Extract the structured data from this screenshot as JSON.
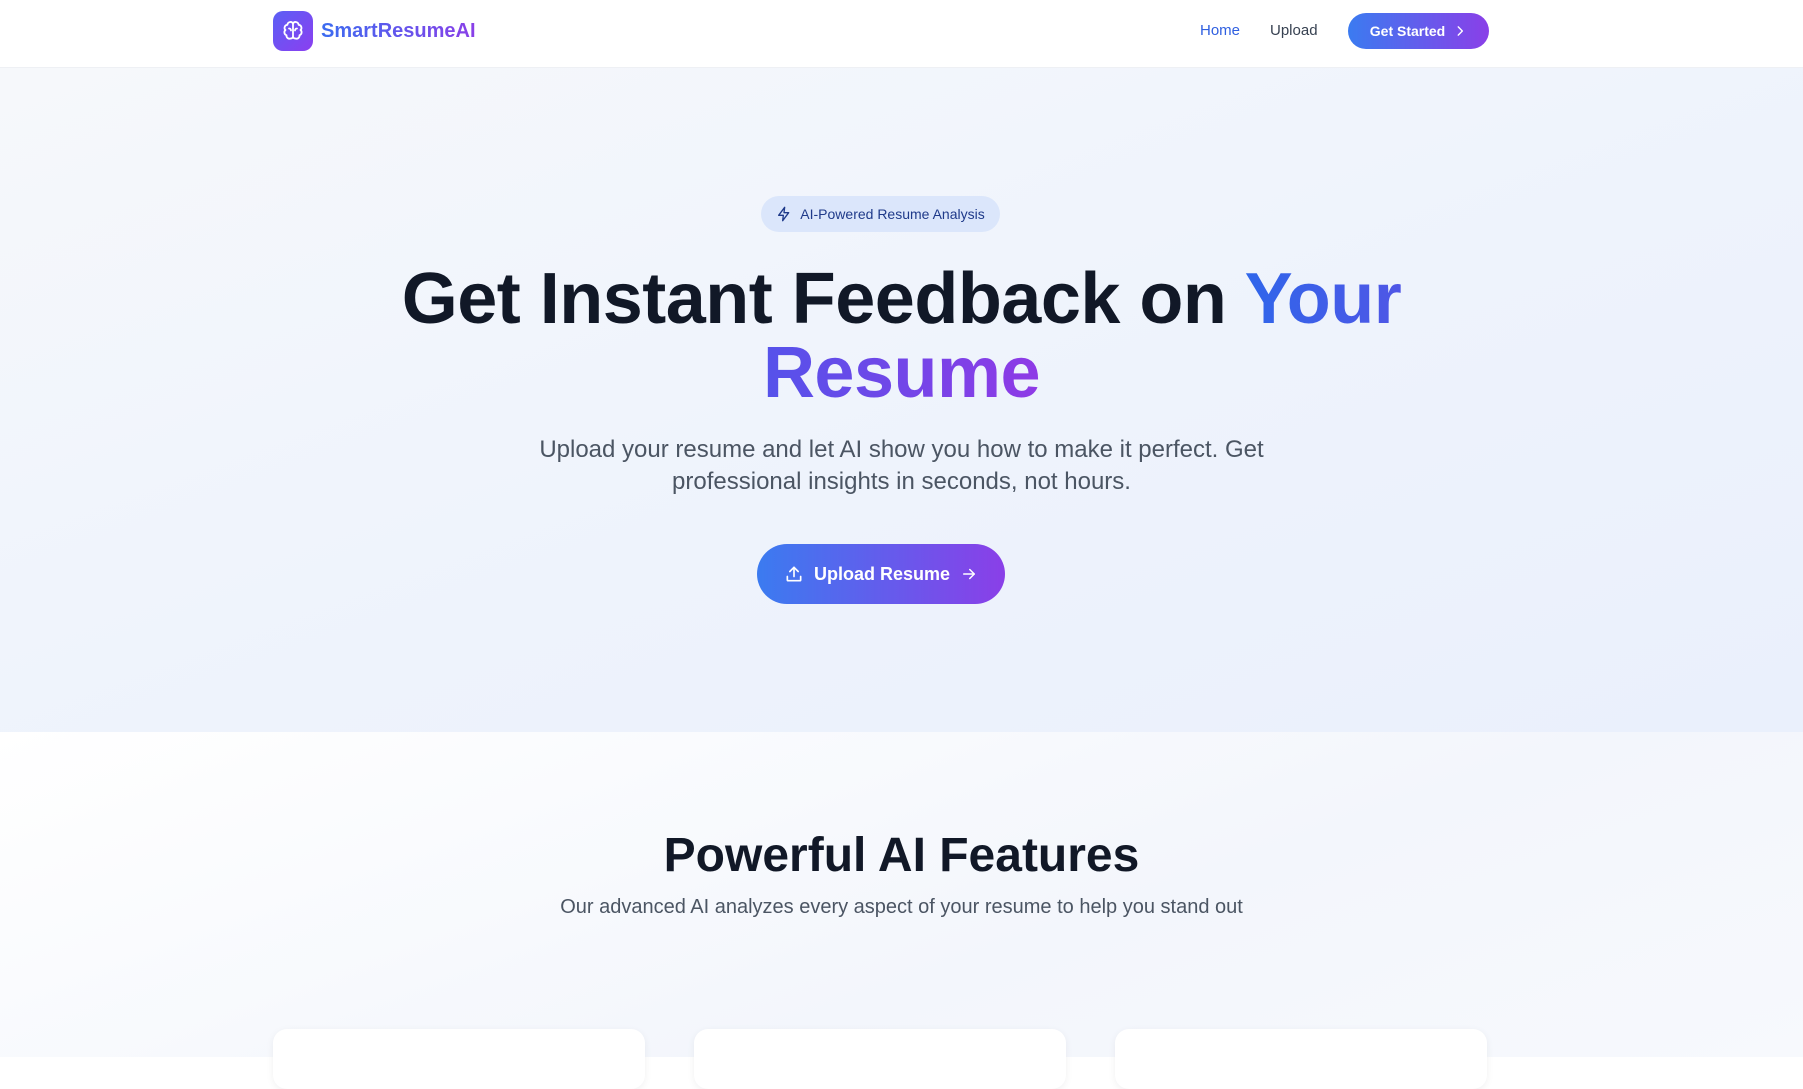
{
  "nav": {
    "brand": "SmartResumeAI",
    "links": [
      "Home",
      "Upload"
    ],
    "cta": "Get Started"
  },
  "hero": {
    "badge": "AI-Powered Resume Analysis",
    "title_plain": "Get Instant Feedback on ",
    "title_highlight_1": "Your",
    "title_highlight_2": "Resume",
    "subtitle": "Upload your resume and let AI show you how to make it perfect. Get professional insights in seconds, not hours.",
    "button": "Upload Resume"
  },
  "features": {
    "title": "Powerful AI Features",
    "subtitle": "Our advanced AI analyzes every aspect of your resume to help you stand out"
  },
  "icons": {
    "brand": "brain-icon",
    "cta": "chevron-right-icon",
    "badge": "lightning-icon",
    "upload": "upload-icon",
    "upload_arrow": "arrow-right-icon"
  },
  "colors": {
    "primary_blue": "#3b7bf0",
    "primary_purple": "#8a3fe8",
    "heading": "#111827",
    "body_text": "#4b5563",
    "badge_bg": "#dbe6fb"
  }
}
